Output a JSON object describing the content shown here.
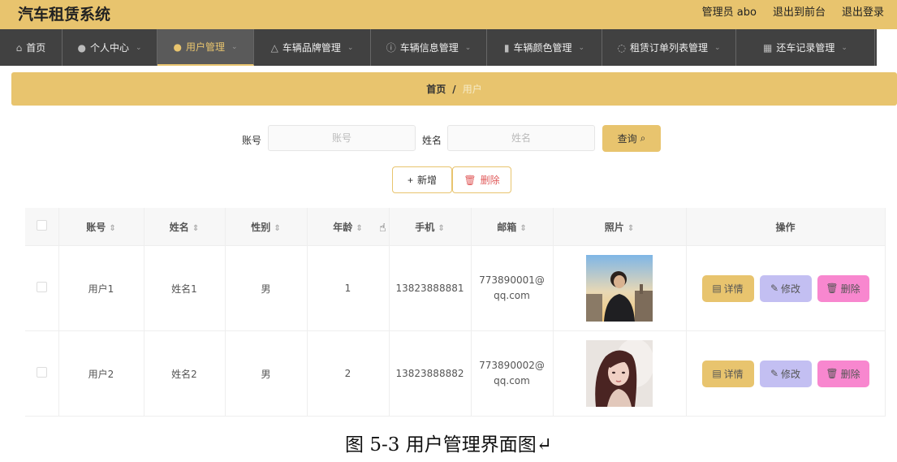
{
  "app": {
    "title": "汽车租赁系统"
  },
  "top_links": {
    "admin": "管理员 abo",
    "front": "退出到前台",
    "logout": "退出登录"
  },
  "nav": [
    {
      "label": "首页",
      "icon": "home-icon",
      "glyph": "⌂",
      "caret": ""
    },
    {
      "label": "个人中心",
      "icon": "user-icon",
      "glyph": "👤",
      "caret": "⌄"
    },
    {
      "label": "用户管理",
      "icon": "user-icon",
      "glyph": "👤",
      "caret": "⌄",
      "active": true
    },
    {
      "label": "车辆品牌管理",
      "icon": "bell-icon",
      "glyph": "△",
      "caret": "⌄"
    },
    {
      "label": "车辆信息管理",
      "icon": "info-icon",
      "glyph": "ⓘ",
      "caret": "⌄"
    },
    {
      "label": "车辆颜色管理",
      "icon": "bar-chart-icon",
      "glyph": "▮",
      "caret": "⌄"
    },
    {
      "label": "租赁订单列表管理",
      "icon": "power-icon",
      "glyph": "◌",
      "caret": "⌄"
    },
    {
      "label": "还车记录管理",
      "icon": "grid-icon",
      "glyph": "▦",
      "caret": "⌄"
    }
  ],
  "breadcrumb": {
    "home": "首页",
    "sep": "/",
    "current": "用户"
  },
  "search": {
    "account_label": "账号",
    "account_placeholder": "账号",
    "account_value": "",
    "name_label": "姓名",
    "name_placeholder": "姓名",
    "name_value": "",
    "button_label": "查询",
    "button_icon": "search-icon",
    "button_glyph": "⌕"
  },
  "actions": {
    "add_label": "新增",
    "add_glyph": "+",
    "add_icon": "plus-icon",
    "delete_label": "删除",
    "delete_glyph": "🗑",
    "delete_icon": "trash-icon"
  },
  "table": {
    "headers": [
      "",
      "账号",
      "姓名",
      "性别",
      "年龄",
      "手机",
      "邮箱",
      "照片",
      "操作"
    ],
    "sort_glyph": "⇕",
    "rows": [
      {
        "account": "用户1",
        "name": "姓名1",
        "gender": "男",
        "age": "1",
        "phone": "13823888881",
        "email": "773890001@qq.com",
        "photo": "photo-man-sunset"
      },
      {
        "account": "用户2",
        "name": "姓名2",
        "gender": "男",
        "age": "2",
        "phone": "13823888882",
        "email": "773890002@qq.com",
        "photo": "photo-woman-portrait"
      }
    ],
    "row_actions": {
      "detail": "详情",
      "detail_glyph": "▤",
      "edit": "修改",
      "edit_glyph": "✎",
      "delete": "删除",
      "delete_glyph": "🗑"
    }
  },
  "caption": "图 5-3 用户管理界面图↵",
  "colors": {
    "accent": "#e8c46e",
    "nav_bg": "#414141",
    "edit": "#c3bff2",
    "delete": "#f887cf",
    "danger_text": "#e05a5a"
  }
}
